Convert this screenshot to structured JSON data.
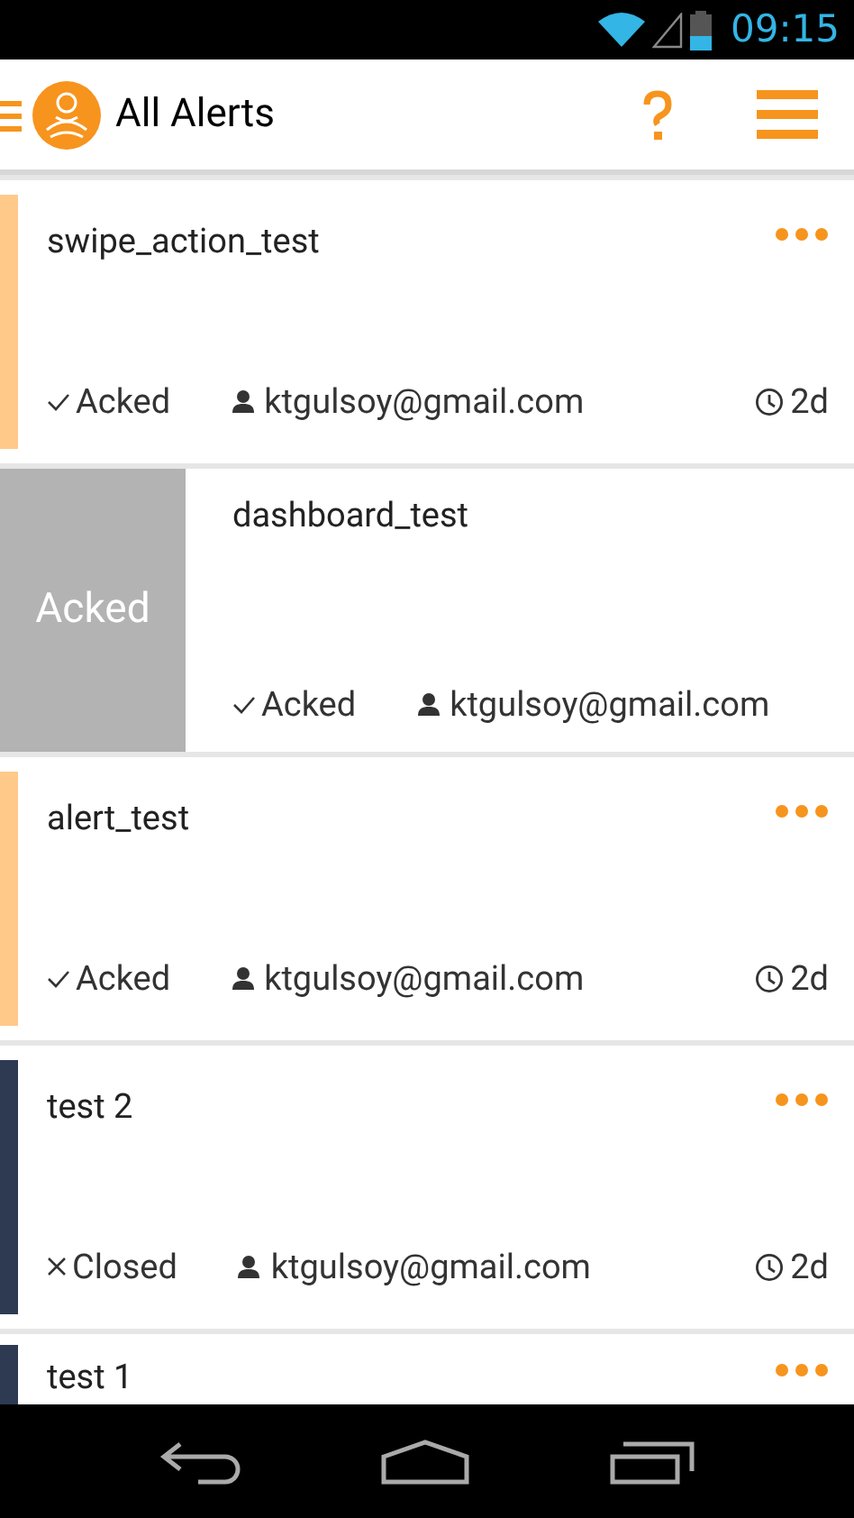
{
  "status_bar": {
    "time": "09:15"
  },
  "header": {
    "title": "All Alerts"
  },
  "alerts": [
    {
      "title": "swipe_action_test",
      "kind": "acked",
      "status": "Acked",
      "user": "ktgulsoy@gmail.com",
      "age": "2d",
      "color": "#ffc98a",
      "swiped": false
    },
    {
      "title": "dashboard_test",
      "kind": "acked",
      "status": "Acked",
      "user": "ktgulsoy@gmail.com",
      "swiped": true,
      "swipe_label": "Acked"
    },
    {
      "title": "alert_test",
      "kind": "acked",
      "status": "Acked",
      "user": "ktgulsoy@gmail.com",
      "age": "2d",
      "color": "#ffc98a",
      "swiped": false
    },
    {
      "title": "test 2",
      "kind": "closed",
      "status": "Closed",
      "user": "ktgulsoy@gmail.com",
      "age": "2d",
      "color": "#2e3a52",
      "swiped": false
    },
    {
      "title": "test 1",
      "color": "#2e3a52",
      "swiped": false
    }
  ]
}
